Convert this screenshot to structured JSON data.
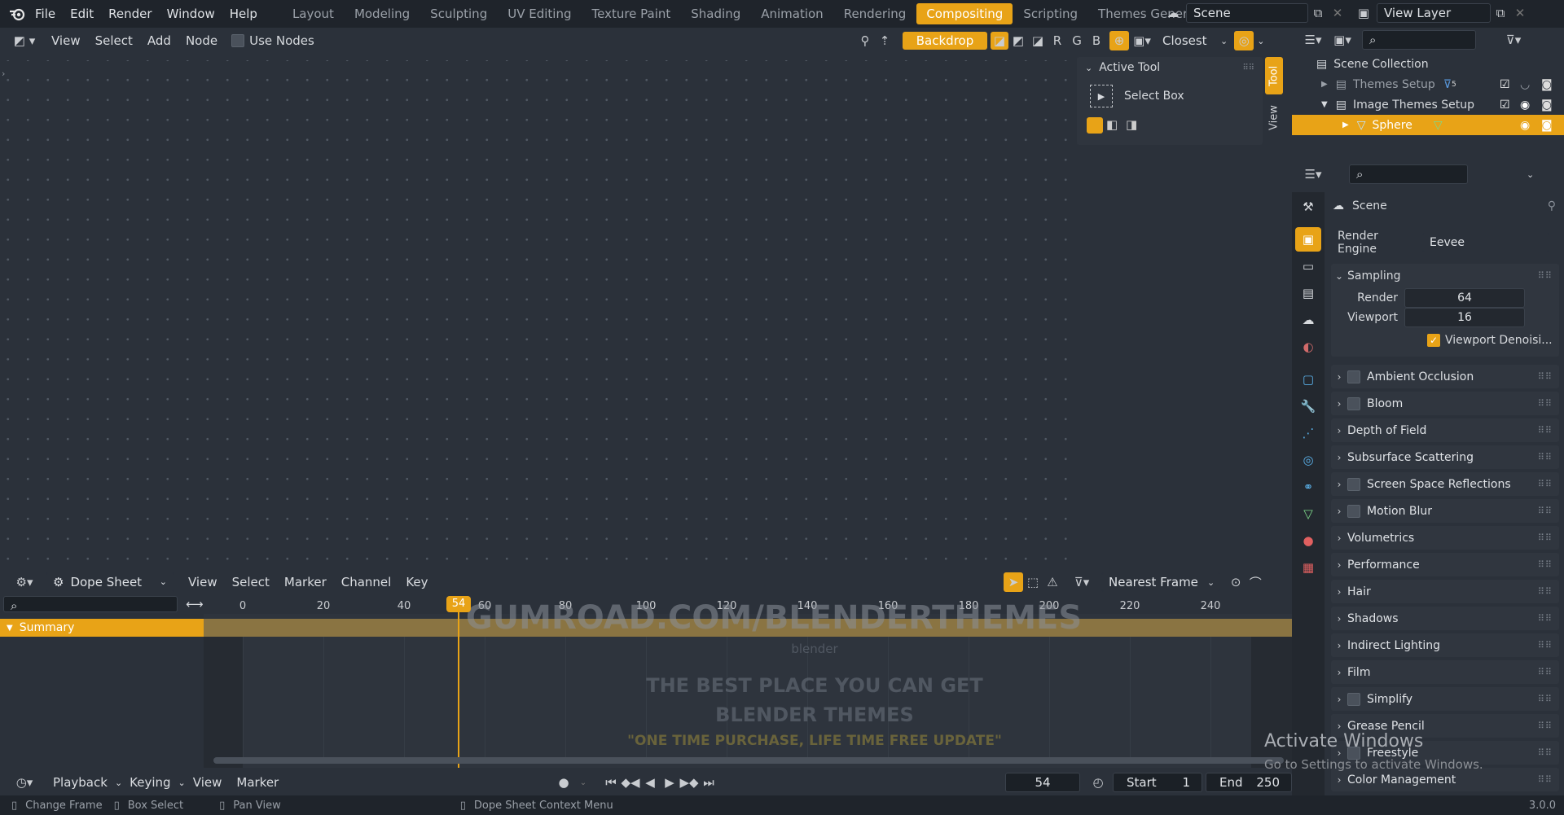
{
  "topbar": {
    "menus": [
      "File",
      "Edit",
      "Render",
      "Window",
      "Help"
    ],
    "workspaces": [
      "Layout",
      "Modeling",
      "Sculpting",
      "UV Editing",
      "Texture Paint",
      "Shading",
      "Animation",
      "Rendering",
      "Compositing",
      "Scripting",
      "Themes Generator"
    ],
    "active_workspace": "Compositing",
    "scene": "Scene",
    "view_layer": "View Layer"
  },
  "node_editor": {
    "menus": [
      "View",
      "Select",
      "Add",
      "Node"
    ],
    "use_nodes": "Use Nodes",
    "backdrop": "Backdrop",
    "channels": [
      "R",
      "G",
      "B"
    ],
    "snap": "Closest"
  },
  "npanel": {
    "header": "Active Tool",
    "tool": "Select Box",
    "tabs": [
      "Tool",
      "View"
    ]
  },
  "outliner": {
    "root": "Scene Collection",
    "items": [
      {
        "label": "Themes Setup",
        "badge": "5"
      },
      {
        "label": "Image Themes Setup"
      },
      {
        "label": "Sphere"
      }
    ]
  },
  "properties": {
    "context": "Scene",
    "render_engine_label": "Render Engine",
    "render_engine": "Eevee",
    "sampling": {
      "label": "Sampling",
      "render_label": "Render",
      "render": "64",
      "viewport_label": "Viewport",
      "viewport": "16",
      "denoise": "Viewport Denoisi..."
    },
    "panels": [
      {
        "label": "Ambient Occlusion",
        "check": true
      },
      {
        "label": "Bloom",
        "check": true
      },
      {
        "label": "Depth of Field",
        "check": false
      },
      {
        "label": "Subsurface Scattering",
        "check": false
      },
      {
        "label": "Screen Space Reflections",
        "check": true
      },
      {
        "label": "Motion Blur",
        "check": true
      },
      {
        "label": "Volumetrics",
        "check": false
      },
      {
        "label": "Performance",
        "check": false
      },
      {
        "label": "Hair",
        "check": false
      },
      {
        "label": "Shadows",
        "check": false
      },
      {
        "label": "Indirect Lighting",
        "check": false
      },
      {
        "label": "Film",
        "check": false
      },
      {
        "label": "Simplify",
        "check": true
      },
      {
        "label": "Grease Pencil",
        "check": false
      },
      {
        "label": "Freestyle",
        "check": true
      },
      {
        "label": "Color Management",
        "check": false
      }
    ]
  },
  "dope": {
    "mode": "Dope Sheet",
    "menus": [
      "View",
      "Select",
      "Marker",
      "Channel",
      "Key"
    ],
    "snap": "Nearest Frame",
    "summary": "Summary",
    "current_frame": "54",
    "ticks": [
      "0",
      "20",
      "40",
      "60",
      "80",
      "100",
      "120",
      "140",
      "160",
      "180",
      "200",
      "220",
      "240"
    ],
    "wm_url": "GUMROAD.COM/BLENDERTHEMES",
    "wm_logo": "blender",
    "wm_line1": "THE BEST PLACE YOU CAN GET",
    "wm_line2": "BLENDER THEMES",
    "wm_line3": "\"ONE TIME PURCHASE, LIFE TIME FREE UPDATE\""
  },
  "timeline": {
    "menus": [
      "Playback",
      "Keying",
      "View",
      "Marker"
    ],
    "frame": "54",
    "start_label": "Start",
    "start": "1",
    "end_label": "End",
    "end": "250"
  },
  "status": {
    "items": [
      "Change Frame",
      "Box Select",
      "Pan View",
      "Dope Sheet Context Menu"
    ],
    "version": "3.0.0"
  },
  "activate": {
    "line1": "Activate Windows",
    "line2": "Go to Settings to activate Windows."
  }
}
